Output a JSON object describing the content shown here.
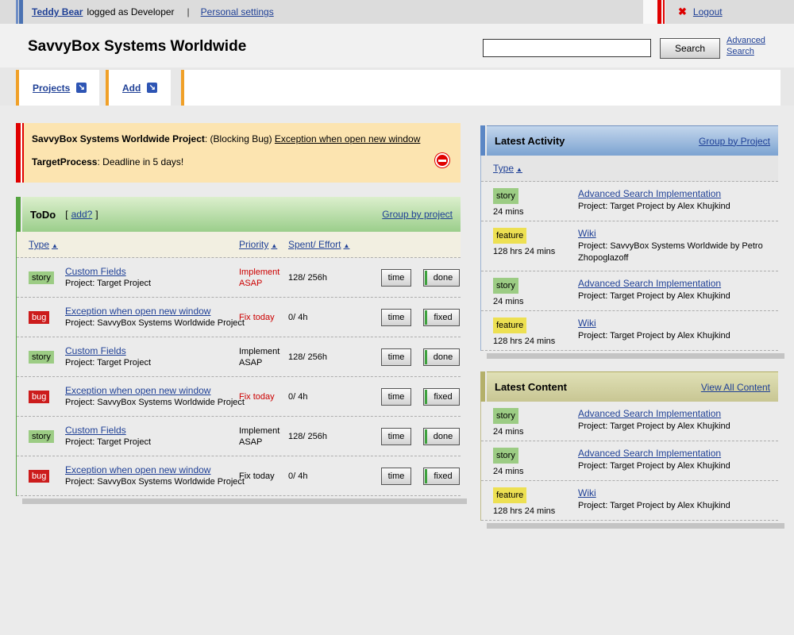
{
  "topbar": {
    "user_name": "Teddy Bear",
    "logged_as": "logged as Developer",
    "divider": "|",
    "personal_settings": "Personal settings",
    "logout_label": "Logout"
  },
  "icons": {
    "logout_x": "✖",
    "tab_arrow": "↘",
    "sort_asc": "▲"
  },
  "header": {
    "title": "SavvyBox Systems Worldwide",
    "search_button_label": "Search",
    "advanced_search_label": "Advanced Search"
  },
  "tabs": [
    {
      "label": "Projects"
    },
    {
      "label": "Add"
    }
  ],
  "alert": {
    "project_bold": "SavvyBox Systems Worldwide Project",
    "blocking_text": ": (Blocking Bug) ",
    "bug_link": "Exception when open new window",
    "process_bold": "TargetProcess",
    "deadline_text": ": Deadline in 5 days!"
  },
  "todo": {
    "title": "ToDo",
    "add_open": "[",
    "add_link": "add?",
    "add_close": "]",
    "group_by_link": "Group by project",
    "col_type": "Type",
    "col_priority": "Priority",
    "col_spent": "Spent/ Effort",
    "rows": [
      {
        "badge": "story",
        "title": "Custom Fields",
        "project": "Project: Target Project",
        "priority": "Implement ASAP",
        "spent": "128/ 256h",
        "time_btn": "time",
        "action_btn": "done"
      },
      {
        "badge": "bug",
        "title": "Exception when open new window",
        "project": "Project: SavvyBox Systems Worldwide Project",
        "priority": "Fix today",
        "spent": "0/ 4h",
        "time_btn": "time",
        "action_btn": "fixed"
      },
      {
        "badge": "story",
        "title": "Custom Fields",
        "project": "Project: Target Project",
        "priority": "Implement ASAP",
        "spent": "128/ 256h",
        "time_btn": "time",
        "action_btn": "done"
      },
      {
        "badge": "bug",
        "title": "Exception when open new window",
        "project": "Project: SavvyBox Systems Worldwide Project",
        "priority": "Fix today",
        "spent": "0/ 4h",
        "time_btn": "time",
        "action_btn": "fixed"
      },
      {
        "badge": "story",
        "title": "Custom Fields",
        "project": "Project: Target Project",
        "priority": "Implement ASAP",
        "spent": "128/ 256h",
        "time_btn": "time",
        "action_btn": "done"
      },
      {
        "badge": "bug",
        "title": "Exception when open new window",
        "project": "Project: SavvyBox Systems Worldwide Project",
        "priority": "Fix today",
        "spent": "0/ 4h",
        "time_btn": "time",
        "action_btn": "fixed"
      }
    ]
  },
  "activity": {
    "title": "Latest Activity",
    "group_by_link": "Group by Project",
    "col_type": "Type",
    "items": [
      {
        "badge": "story",
        "duration": "24 mins",
        "link": "Advanced Search Implementation",
        "detail": "Project: Target Project by Alex Khujkind"
      },
      {
        "badge": "feature",
        "duration": "128 hrs 24 mins",
        "link": "Wiki",
        "detail": "Project: SavvyBox Systems Worldwide by Petro Zhopoglazoff"
      },
      {
        "badge": "story",
        "duration": "24 mins",
        "link": "Advanced Search Implementation",
        "detail": "Project: Target Project by Alex Khujkind"
      },
      {
        "badge": "feature",
        "duration": "128 hrs 24 mins",
        "link": "Wiki",
        "detail": "Project: Target Project by Alex Khujkind"
      }
    ]
  },
  "latest_content": {
    "title": "Latest Content",
    "view_all_link": "View All Content",
    "items": [
      {
        "badge": "story",
        "duration": "24 mins",
        "link": "Advanced Search Implementation",
        "detail": "Project: Target Project by Alex Khujkind"
      },
      {
        "badge": "story",
        "duration": "24 mins",
        "link": "Advanced Search Implementation",
        "detail": "Project: Target Project by Alex Khujkind"
      },
      {
        "badge": "feature",
        "duration": "128 hrs 24 mins",
        "link": "Wiki",
        "detail": "Project: Target Project by Alex Khujkind"
      }
    ]
  },
  "colors": {
    "link": "#1f4096",
    "alert_bg": "#fce4b0",
    "accent_red": "#e00000",
    "story_badge": "#9ccc84",
    "bug_badge": "#cc1c1c",
    "feature_badge": "#ede052",
    "todo_accent": "#55a440",
    "activity_accent": "#5b87c5",
    "content_accent": "#b4b06a",
    "tab_accent": "#f0a028"
  }
}
